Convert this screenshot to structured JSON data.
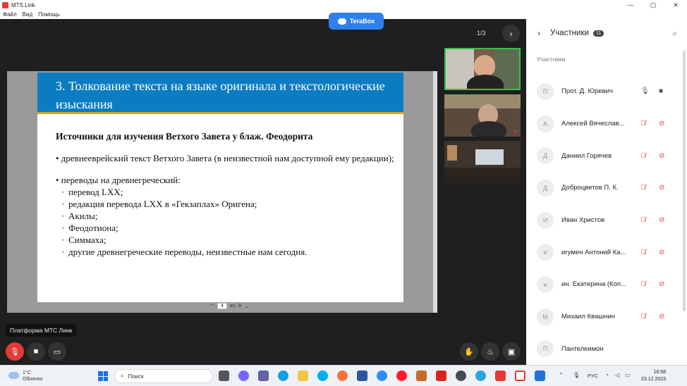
{
  "window": {
    "title": "MTS Link",
    "min": "—",
    "max": "▢",
    "close": "✕"
  },
  "menu": [
    "Файл",
    "Вид",
    "Помощь"
  ],
  "terabox": {
    "label": "TeraBox"
  },
  "pager": {
    "text": "1/3",
    "next": "›"
  },
  "slide": {
    "title": "3. Толкование текста на языке оригинала и текстологические изыскания",
    "subtitle": "Источники для изучения Ветхого Завета у блаж. Феодорита",
    "bullet1": "• древнееврейский текст Ветхого Завета (в неизвестной нам доступной ему редакции);",
    "bullet2": "• переводы на древнегреческий:",
    "subitems": [
      "перевод LXX;",
      "редакция перевода LXX в «Гекзаплах» Оригена;",
      "Акилы;",
      "Феодотиона;",
      "Симмаха;",
      "другие древнегреческие переводы, неизвестные нам сегодня."
    ]
  },
  "pagination": {
    "up": "⌃",
    "current": "4",
    "of": "из",
    "total": "9",
    "down": "⌄"
  },
  "tooltip": "Платформа МТС Линк",
  "sidebar": {
    "title": "Участники",
    "count": "11",
    "section": "Участники",
    "participants": [
      {
        "initial": "П",
        "name": "Прот. Д. Юревич",
        "muted": false
      },
      {
        "initial": "А",
        "name": "Алексей Вячеслав...",
        "muted": true
      },
      {
        "initial": "Д",
        "name": "Даниил Горячев",
        "muted": true
      },
      {
        "initial": "Д",
        "name": "Доброцветов П. К.",
        "muted": true
      },
      {
        "initial": "И",
        "name": "Иван Христов",
        "muted": true
      },
      {
        "initial": "и",
        "name": "игумен Антоний Ка...",
        "muted": true
      },
      {
        "initial": "и",
        "name": "ин. Екатерина (Коп...",
        "muted": true
      },
      {
        "initial": "М",
        "name": "Михаил Квашнин",
        "muted": true
      },
      {
        "initial": "П",
        "name": "Пантелеимон",
        "muted": null
      }
    ]
  },
  "taskbar": {
    "temp": "1°C",
    "weather": "Облачно",
    "search": "Поиск",
    "lang": "РУС",
    "time": "16:58",
    "date": "23.12.2023"
  },
  "colors": {
    "accent": "#0c7cc2",
    "muted": "#e53935",
    "active_border": "#37c14b"
  }
}
